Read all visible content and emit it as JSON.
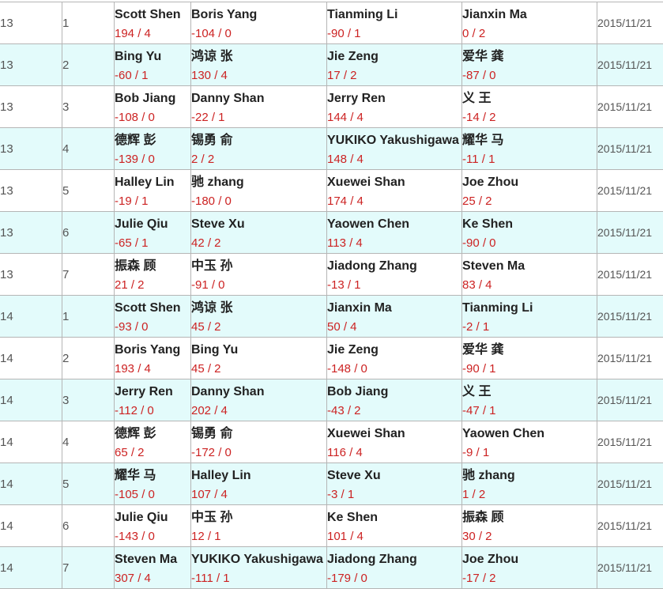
{
  "colors": {
    "score": "#cc2222",
    "alt_row_bg": "#e3fbfb",
    "border": "#b5b5b5"
  },
  "rows": [
    {
      "round": "13",
      "table": "1",
      "date": "2015/11/21",
      "players": [
        {
          "name": "Scott Shen",
          "score": "194 / 4"
        },
        {
          "name": "Boris Yang",
          "score": "-104 / 0"
        },
        {
          "name": "Tianming Li",
          "score": "-90 / 1"
        },
        {
          "name": "Jianxin Ma",
          "score": "0 / 2"
        }
      ]
    },
    {
      "round": "13",
      "table": "2",
      "date": "2015/11/21",
      "players": [
        {
          "name": "Bing Yu",
          "score": "-60 / 1"
        },
        {
          "name": "鸿谅 张",
          "score": "130 / 4"
        },
        {
          "name": "Jie Zeng",
          "score": "17 / 2"
        },
        {
          "name": "爱华 龚",
          "score": "-87 / 0"
        }
      ]
    },
    {
      "round": "13",
      "table": "3",
      "date": "2015/11/21",
      "players": [
        {
          "name": "Bob Jiang",
          "score": "-108 / 0"
        },
        {
          "name": "Danny Shan",
          "score": "-22 / 1"
        },
        {
          "name": "Jerry Ren",
          "score": "144 / 4"
        },
        {
          "name": "义 王",
          "score": "-14 / 2"
        }
      ]
    },
    {
      "round": "13",
      "table": "4",
      "date": "2015/11/21",
      "players": [
        {
          "name": "德辉 彭",
          "score": "-139 / 0"
        },
        {
          "name": "锡勇 俞",
          "score": "2 / 2"
        },
        {
          "name": "YUKIKO Yakushigawa",
          "score": "148 / 4"
        },
        {
          "name": "耀华 马",
          "score": "-11 / 1"
        }
      ]
    },
    {
      "round": "13",
      "table": "5",
      "date": "2015/11/21",
      "players": [
        {
          "name": "Halley Lin",
          "score": "-19 / 1"
        },
        {
          "name": "驰 zhang",
          "score": "-180 / 0"
        },
        {
          "name": "Xuewei Shan",
          "score": "174 / 4"
        },
        {
          "name": "Joe Zhou",
          "score": "25 / 2"
        }
      ]
    },
    {
      "round": "13",
      "table": "6",
      "date": "2015/11/21",
      "players": [
        {
          "name": "Julie Qiu",
          "score": "-65 / 1"
        },
        {
          "name": "Steve Xu",
          "score": "42 / 2"
        },
        {
          "name": "Yaowen Chen",
          "score": "113 / 4"
        },
        {
          "name": "Ke Shen",
          "score": "-90 / 0"
        }
      ]
    },
    {
      "round": "13",
      "table": "7",
      "date": "2015/11/21",
      "players": [
        {
          "name": "振森 顾",
          "score": "21 / 2"
        },
        {
          "name": "中玉 孙",
          "score": "-91 / 0"
        },
        {
          "name": "Jiadong Zhang",
          "score": "-13 / 1"
        },
        {
          "name": "Steven Ma",
          "score": "83 / 4"
        }
      ]
    },
    {
      "round": "14",
      "table": "1",
      "date": "2015/11/21",
      "players": [
        {
          "name": "Scott Shen",
          "score": "-93 / 0"
        },
        {
          "name": "鸿谅 张",
          "score": "45 / 2"
        },
        {
          "name": "Jianxin Ma",
          "score": "50 / 4"
        },
        {
          "name": "Tianming Li",
          "score": "-2 / 1"
        }
      ]
    },
    {
      "round": "14",
      "table": "2",
      "date": "2015/11/21",
      "players": [
        {
          "name": "Boris Yang",
          "score": "193 / 4"
        },
        {
          "name": "Bing Yu",
          "score": "45 / 2"
        },
        {
          "name": "Jie Zeng",
          "score": "-148 / 0"
        },
        {
          "name": "爱华 龚",
          "score": "-90 / 1"
        }
      ]
    },
    {
      "round": "14",
      "table": "3",
      "date": "2015/11/21",
      "players": [
        {
          "name": "Jerry Ren",
          "score": "-112 / 0"
        },
        {
          "name": "Danny Shan",
          "score": "202 / 4"
        },
        {
          "name": "Bob Jiang",
          "score": "-43 / 2"
        },
        {
          "name": "义 王",
          "score": "-47 / 1"
        }
      ]
    },
    {
      "round": "14",
      "table": "4",
      "date": "2015/11/21",
      "players": [
        {
          "name": "德辉 彭",
          "score": "65 / 2"
        },
        {
          "name": "锡勇 俞",
          "score": "-172 / 0"
        },
        {
          "name": "Xuewei Shan",
          "score": "116 / 4"
        },
        {
          "name": "Yaowen Chen",
          "score": "-9 / 1"
        }
      ]
    },
    {
      "round": "14",
      "table": "5",
      "date": "2015/11/21",
      "players": [
        {
          "name": "耀华 马",
          "score": "-105 / 0"
        },
        {
          "name": "Halley Lin",
          "score": "107 / 4"
        },
        {
          "name": "Steve Xu",
          "score": "-3 / 1"
        },
        {
          "name": "驰 zhang",
          "score": "1 / 2"
        }
      ]
    },
    {
      "round": "14",
      "table": "6",
      "date": "2015/11/21",
      "players": [
        {
          "name": "Julie Qiu",
          "score": "-143 / 0"
        },
        {
          "name": "中玉 孙",
          "score": "12 / 1"
        },
        {
          "name": "Ke Shen",
          "score": "101 / 4"
        },
        {
          "name": "振森 顾",
          "score": "30 / 2"
        }
      ]
    },
    {
      "round": "14",
      "table": "7",
      "date": "2015/11/21",
      "players": [
        {
          "name": "Steven Ma",
          "score": "307 / 4"
        },
        {
          "name": "YUKIKO Yakushigawa",
          "score": "-111 / 1"
        },
        {
          "name": "Jiadong Zhang",
          "score": "-179 / 0"
        },
        {
          "name": "Joe Zhou",
          "score": "-17 / 2"
        }
      ]
    }
  ]
}
